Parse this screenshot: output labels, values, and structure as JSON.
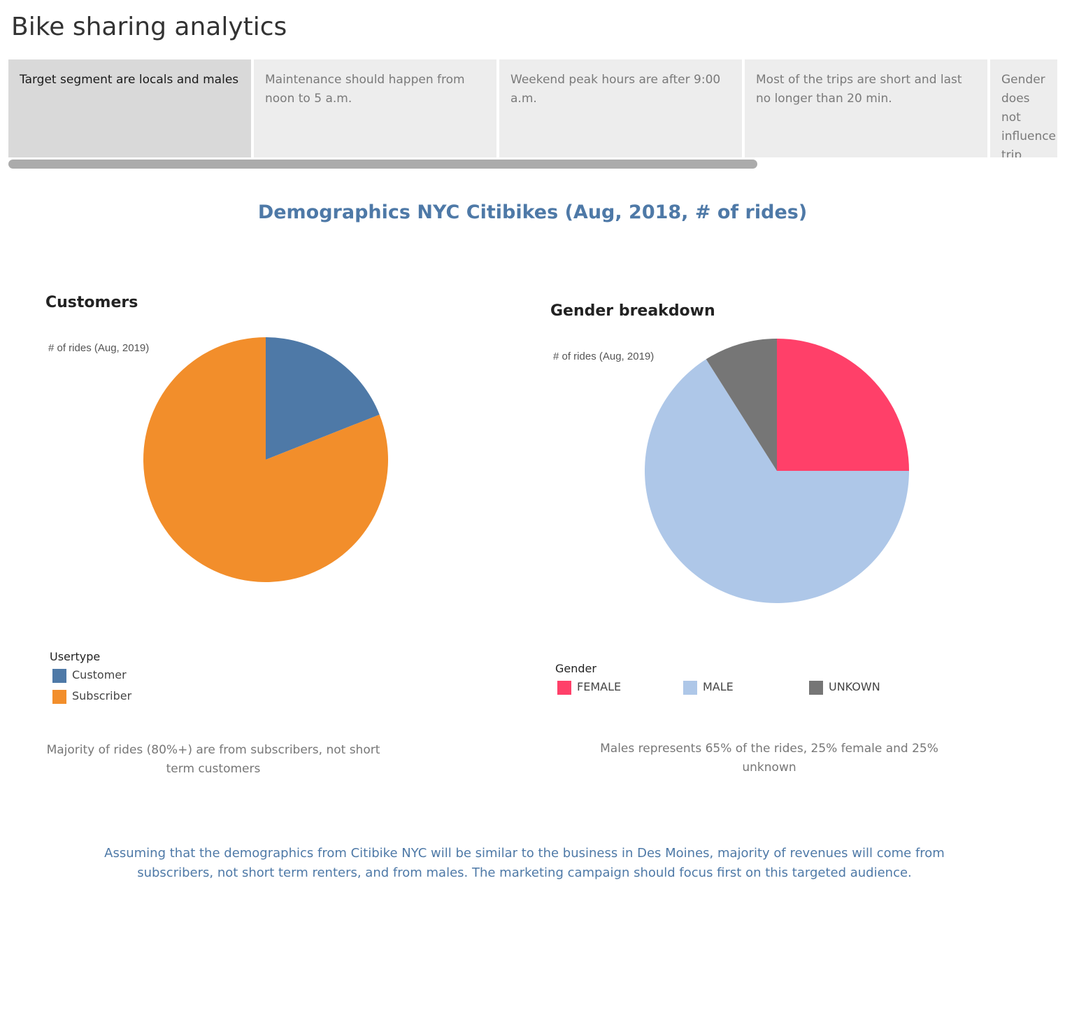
{
  "page_title": "Bike sharing analytics",
  "story_points": [
    "Target segment are locals and males",
    "Maintenance should happen from noon to 5 a.m.",
    "Weekend peak hours are after 9:00 a.m.",
    "Most of the trips are short and last no longer than 20 min.",
    "Gender does not influence trip len.."
  ],
  "dashboard_title": "Demographics NYC Citibikes (Aug, 2018, # of rides)",
  "chart_data": [
    {
      "type": "pie",
      "title": "Customers",
      "measure_label": "# of rides (Aug, 2019)",
      "legend_title": "Usertype",
      "categories": [
        "Customer",
        "Subscriber"
      ],
      "values": [
        19,
        81
      ],
      "colors": [
        "#4e79a7",
        "#f28e2b"
      ]
    },
    {
      "type": "pie",
      "title": "Gender breakdown",
      "measure_label": "# of rides (Aug, 2019)",
      "legend_title": "Gender",
      "categories": [
        "FEMALE",
        "MALE",
        "UNKOWN"
      ],
      "values": [
        25,
        66,
        9
      ],
      "colors": [
        "#ff4069",
        "#aec7e8",
        "#767676"
      ]
    }
  ],
  "captions": {
    "customers": "Majority of rides (80%+) are from subscribers, not short term customers",
    "gender": "Males represents 65% of the rides, 25% female and 25% unknown"
  },
  "conclusion": "Assuming that the demographics from Citibike NYC will be similar to the business in Des Moines, majority of revenues will come from subscribers, not short term renters, and from males. The marketing campaign should focus first on this targeted audience."
}
